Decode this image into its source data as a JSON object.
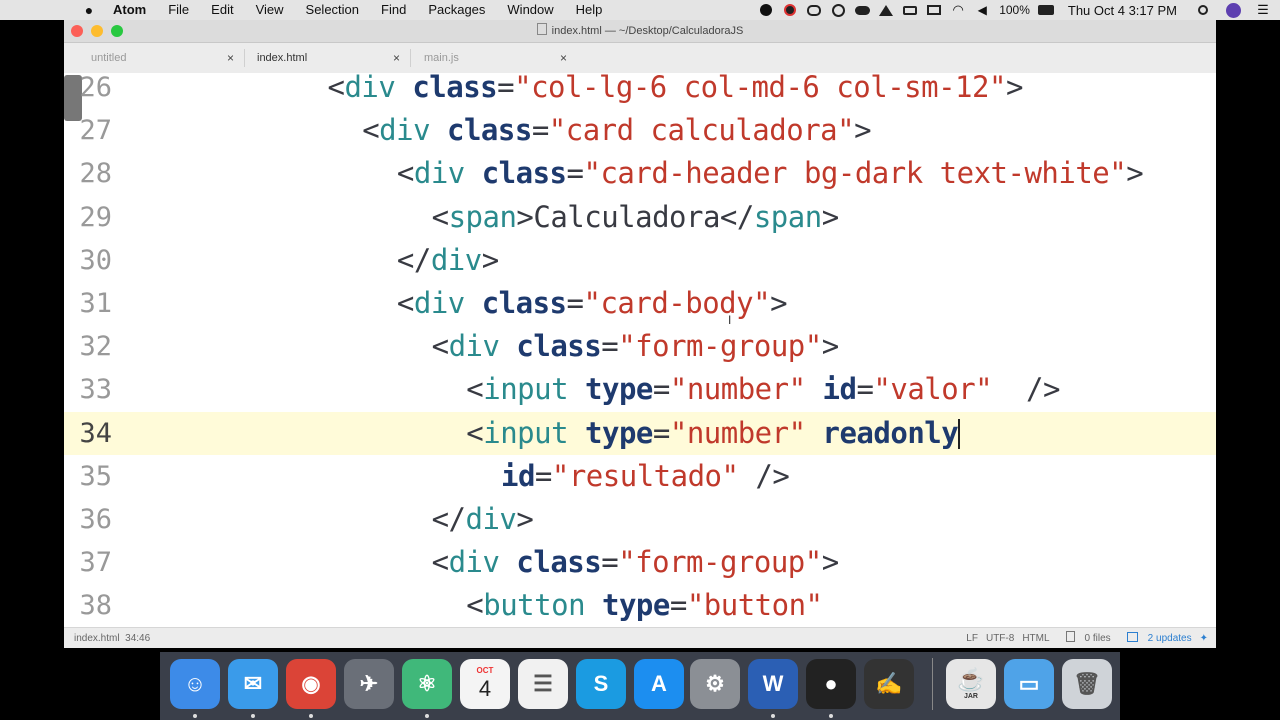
{
  "menubar": {
    "items": [
      "Atom",
      "File",
      "Edit",
      "View",
      "Selection",
      "Find",
      "Packages",
      "Window",
      "Help"
    ],
    "battery": "100%",
    "clock": "Thu Oct 4  3:17 PM",
    "status_icons": [
      "record-icon",
      "antivirus-icon",
      "cc-icon",
      "circle-icon",
      "cloud-icon",
      "upload-icon",
      "battery-small-icon",
      "airplay-icon",
      "wifi-icon",
      "volume-icon",
      "battery-icon",
      "search-icon",
      "user-icon",
      "list-icon"
    ]
  },
  "window": {
    "title": "index.html — ~/Desktop/CalculadoraJS",
    "tabs": [
      {
        "label": "untitled",
        "active": false
      },
      {
        "label": "index.html",
        "active": true
      },
      {
        "label": "main.js",
        "active": false
      }
    ],
    "close_glyph": "×"
  },
  "editor": {
    "cursor_line": 34,
    "lines": [
      {
        "num": "26",
        "indent": 10,
        "tokens": [
          [
            "p",
            "<"
          ],
          [
            "t",
            "div"
          ],
          [
            "p",
            " "
          ],
          [
            "a",
            "class"
          ],
          [
            "p",
            "="
          ],
          [
            "s",
            "\"col-lg-6 col-md-6 col-sm-12\""
          ],
          [
            "p",
            ">"
          ]
        ]
      },
      {
        "num": "27",
        "indent": 12,
        "tokens": [
          [
            "p",
            "<"
          ],
          [
            "t",
            "div"
          ],
          [
            "p",
            " "
          ],
          [
            "a",
            "class"
          ],
          [
            "p",
            "="
          ],
          [
            "s",
            "\"card calculadora\""
          ],
          [
            "p",
            ">"
          ]
        ]
      },
      {
        "num": "28",
        "indent": 14,
        "tokens": [
          [
            "p",
            "<"
          ],
          [
            "t",
            "div"
          ],
          [
            "p",
            " "
          ],
          [
            "a",
            "class"
          ],
          [
            "p",
            "="
          ],
          [
            "s",
            "\"card-header bg-dark text-white\""
          ],
          [
            "p",
            ">"
          ]
        ]
      },
      {
        "num": "29",
        "indent": 16,
        "tokens": [
          [
            "p",
            "<"
          ],
          [
            "t",
            "span"
          ],
          [
            "p",
            ">Calculadora</"
          ],
          [
            "t",
            "span"
          ],
          [
            "p",
            ">"
          ]
        ]
      },
      {
        "num": "30",
        "indent": 14,
        "tokens": [
          [
            "p",
            "</"
          ],
          [
            "t",
            "div"
          ],
          [
            "p",
            ">"
          ]
        ]
      },
      {
        "num": "31",
        "indent": 14,
        "tokens": [
          [
            "p",
            "<"
          ],
          [
            "t",
            "div"
          ],
          [
            "p",
            " "
          ],
          [
            "a",
            "class"
          ],
          [
            "p",
            "="
          ],
          [
            "s",
            "\"card-body\""
          ],
          [
            "p",
            ">"
          ]
        ]
      },
      {
        "num": "32",
        "indent": 16,
        "tokens": [
          [
            "p",
            "<"
          ],
          [
            "t",
            "div"
          ],
          [
            "p",
            " "
          ],
          [
            "a",
            "class"
          ],
          [
            "p",
            "="
          ],
          [
            "s",
            "\"form-group\""
          ],
          [
            "p",
            ">"
          ]
        ]
      },
      {
        "num": "33",
        "indent": 18,
        "tokens": [
          [
            "p",
            "<"
          ],
          [
            "t",
            "input"
          ],
          [
            "p",
            " "
          ],
          [
            "a",
            "type"
          ],
          [
            "p",
            "="
          ],
          [
            "s",
            "\"number\""
          ],
          [
            "p",
            " "
          ],
          [
            "a",
            "id"
          ],
          [
            "p",
            "="
          ],
          [
            "s",
            "\"valor\""
          ],
          [
            "p",
            "  />"
          ]
        ]
      },
      {
        "num": "34",
        "indent": 18,
        "tokens": [
          [
            "p",
            "<"
          ],
          [
            "t",
            "input"
          ],
          [
            "p",
            " "
          ],
          [
            "a",
            "type"
          ],
          [
            "p",
            "="
          ],
          [
            "s",
            "\"number\""
          ],
          [
            "p",
            " "
          ],
          [
            "a",
            "readonly"
          ]
        ]
      },
      {
        "num": "35",
        "indent": 20,
        "tokens": [
          [
            "a",
            "id"
          ],
          [
            "p",
            "="
          ],
          [
            "s",
            "\"resultado\""
          ],
          [
            "p",
            " />"
          ]
        ]
      },
      {
        "num": "36",
        "indent": 16,
        "tokens": [
          [
            "p",
            "</"
          ],
          [
            "t",
            "div"
          ],
          [
            "p",
            ">"
          ]
        ]
      },
      {
        "num": "37",
        "indent": 16,
        "tokens": [
          [
            "p",
            "<"
          ],
          [
            "t",
            "div"
          ],
          [
            "p",
            " "
          ],
          [
            "a",
            "class"
          ],
          [
            "p",
            "="
          ],
          [
            "s",
            "\"form-group\""
          ],
          [
            "p",
            ">"
          ]
        ]
      },
      {
        "num": "38",
        "indent": 18,
        "tokens": [
          [
            "p",
            "<"
          ],
          [
            "t",
            "button"
          ],
          [
            "p",
            " "
          ],
          [
            "a",
            "type"
          ],
          [
            "p",
            "="
          ],
          [
            "s",
            "\"button\""
          ]
        ]
      }
    ]
  },
  "statusbar": {
    "file": "index.html",
    "position": "34:46",
    "line_ending": "LF",
    "encoding": "UTF-8",
    "grammar": "HTML",
    "git_files": "0 files",
    "updates": "2 updates"
  },
  "dock": {
    "apps": [
      {
        "name": "finder",
        "glyph": "☺",
        "color": "#3d8be8"
      },
      {
        "name": "mail",
        "glyph": "✉",
        "color": "#3a9bea"
      },
      {
        "name": "chrome",
        "glyph": "◉",
        "color": "#db4437"
      },
      {
        "name": "launchpad",
        "glyph": "✈",
        "color": "#6a6f78"
      },
      {
        "name": "atom",
        "glyph": "⚛",
        "color": "#40b87a"
      },
      {
        "name": "calendar",
        "glyph": "4",
        "color": "#f4f4f4"
      },
      {
        "name": "notes",
        "glyph": "☰",
        "color": "#f1f1f1"
      },
      {
        "name": "skype",
        "glyph": "S",
        "color": "#1b9be1"
      },
      {
        "name": "app-store",
        "glyph": "A",
        "color": "#1c8ef0"
      },
      {
        "name": "system-preferences",
        "glyph": "⚙",
        "color": "#8b8f95"
      },
      {
        "name": "word",
        "glyph": "W",
        "color": "#2b5fb4"
      },
      {
        "name": "obs",
        "glyph": "●",
        "color": "#222"
      },
      {
        "name": "signature",
        "glyph": "✍",
        "color": "#333"
      },
      {
        "name": "java-jar",
        "glyph": "☕",
        "color": "#e6e6e6"
      },
      {
        "name": "folder",
        "glyph": "▭",
        "color": "#4fa3e8"
      },
      {
        "name": "trash",
        "glyph": "🗑",
        "color": "#cfd3d8"
      }
    ],
    "calendar_month": "OCT",
    "jar_label": "JAR"
  }
}
